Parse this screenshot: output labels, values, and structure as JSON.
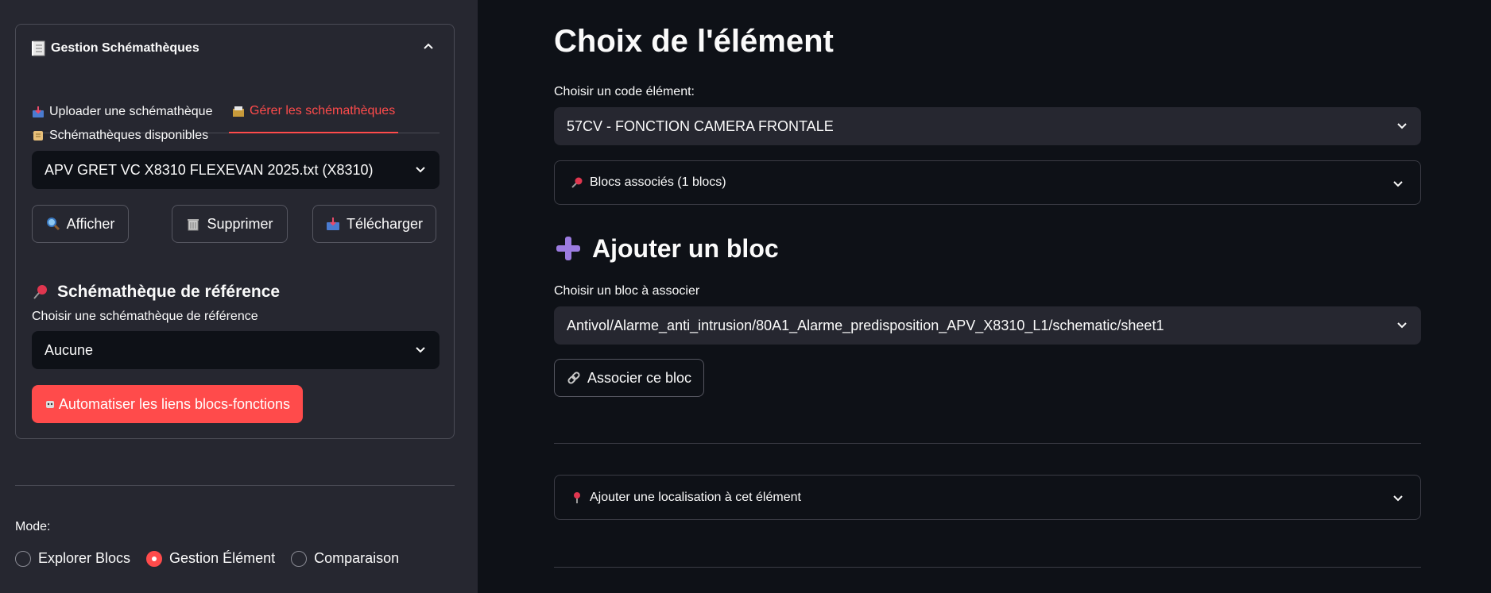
{
  "sidebar": {
    "expander_title": "Gestion Schémathèques",
    "tabs": [
      {
        "label": "Uploader une schémathèque"
      },
      {
        "label": "Gérer les schémathèques"
      }
    ],
    "available_label": "Schémathèques disponibles",
    "available_selected": "APV GRET VC X8310 FLEXEVAN 2025.txt (X8310)",
    "buttons": {
      "show": "Afficher",
      "delete": "Supprimer",
      "download": "Télécharger"
    },
    "reference_title": "Schémathèque de référence",
    "reference_label": "Choisir une schémathèque de référence",
    "reference_selected": "Aucune",
    "automate_button": "Automatiser les liens blocs-fonctions",
    "mode_label": "Mode:",
    "modes": [
      {
        "label": "Explorer Blocs",
        "selected": false
      },
      {
        "label": "Gestion Élément",
        "selected": true
      },
      {
        "label": "Comparaison",
        "selected": false
      }
    ]
  },
  "main": {
    "title": "Choix de l'élément",
    "element_label": "Choisir un code élément:",
    "element_selected": "57CV - FONCTION CAMERA FRONTALE",
    "blocks_expander": "Blocs associés (1 blocs)",
    "add_block_title": "Ajouter un bloc",
    "block_label": "Choisir un bloc à associer",
    "block_selected": "Antivol/Alarme_anti_intrusion/80A1_Alarme_predisposition_APV_X8310_L1/schematic/sheet1",
    "associate_button": "Associer ce bloc",
    "location_expander": "Ajouter une localisation à cet élément"
  },
  "colors": {
    "accent": "#ff4b4b",
    "sidebar_bg": "#262730",
    "main_bg": "#0e1117"
  }
}
